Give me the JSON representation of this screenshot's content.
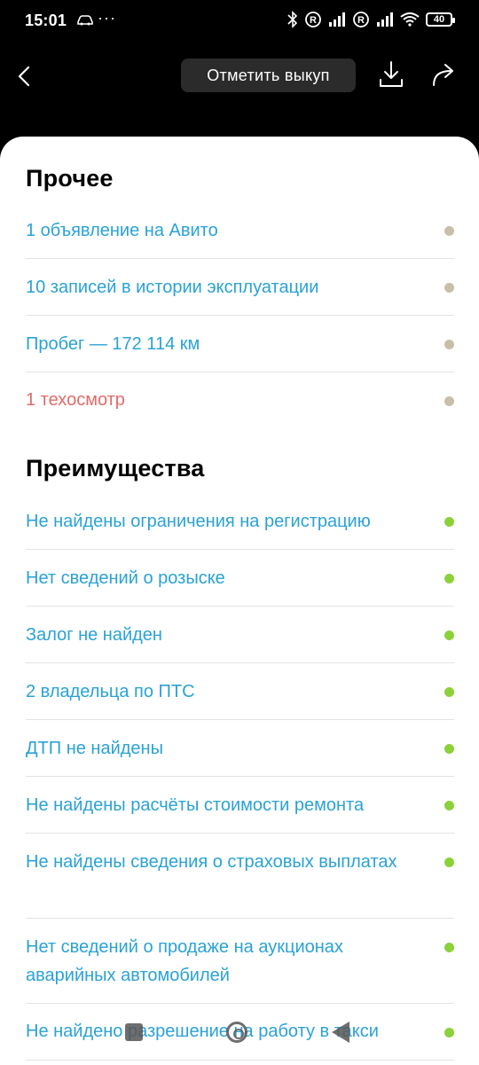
{
  "status_bar": {
    "time": "15:01",
    "more": "···",
    "battery": "40",
    "icons": [
      "car-icon",
      "bluetooth-icon",
      "roaming-icon",
      "signal-icon",
      "roaming-icon",
      "signal-icon",
      "wifi-icon",
      "battery-icon"
    ]
  },
  "toolbar": {
    "mark_button_label": "Отметить выкуп",
    "icons": [
      "back-icon",
      "download-icon",
      "share-icon"
    ]
  },
  "sections": {
    "other": {
      "title": "Прочее",
      "items": [
        {
          "text": "1 объявление на Авито",
          "status": "neutral"
        },
        {
          "text": "10 записей в истории эксплуатации",
          "status": "neutral"
        },
        {
          "text": "Пробег — 172 114 км",
          "status": "neutral"
        },
        {
          "text": "1 техосмотр",
          "status": "neutral"
        }
      ]
    },
    "advantages": {
      "title": "Преимущества",
      "items": [
        {
          "text": "Не найдены ограничения на регистрацию",
          "status": "ok"
        },
        {
          "text": "Нет сведений о розыске",
          "status": "ok"
        },
        {
          "text": "Залог не найден",
          "status": "ok"
        },
        {
          "text": "2 владельца по ПТС",
          "status": "ok"
        },
        {
          "text": "ДТП не найдены",
          "status": "ok"
        },
        {
          "text": "Не найдены расчёты стоимости ремонта",
          "status": "ok"
        },
        {
          "text": "Не найдены сведения о страховых выплатах",
          "status": "ok"
        },
        {
          "text": "Нет сведений о продаже на аукционах аварийных автомобилей",
          "status": "ok"
        },
        {
          "text": "Не найдено разрешение на работу в такси",
          "status": "ok"
        }
      ]
    }
  },
  "colors": {
    "link": "#2aa2d6",
    "warning_text": "#e26b6b",
    "neutral_dot": "#c8bfa8",
    "ok_dot": "#8cd13a"
  }
}
